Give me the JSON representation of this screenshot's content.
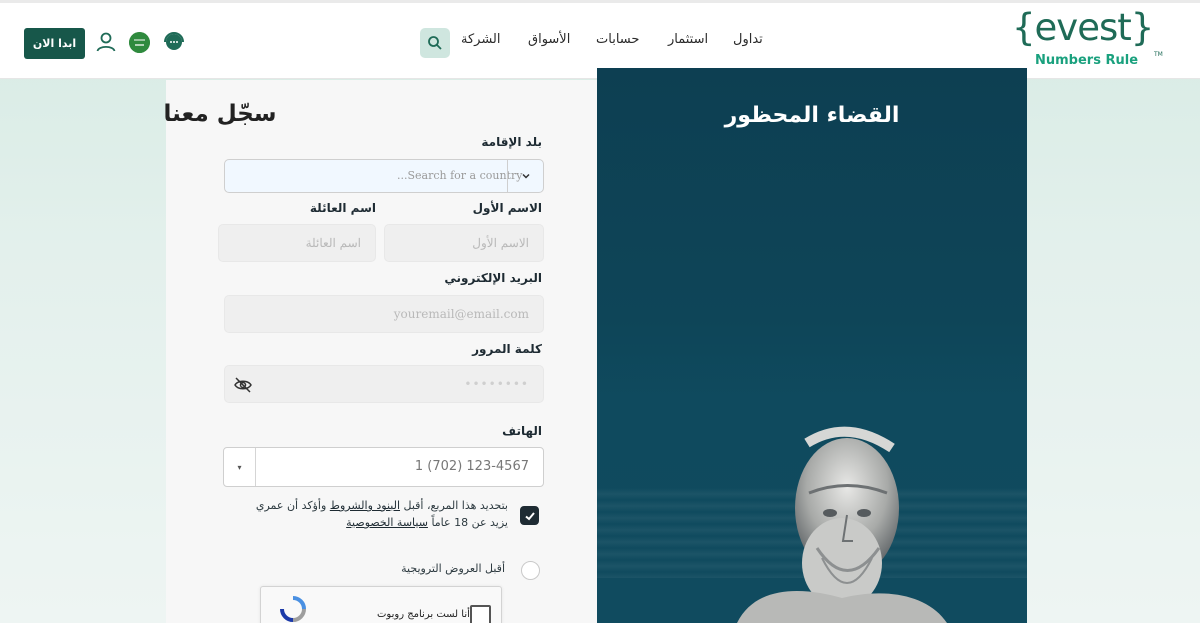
{
  "header": {
    "start_label": "ابدا الان",
    "nav": {
      "trade": "تداول",
      "invest": "استثمار",
      "accounts": "حسابات",
      "markets": "الأسواق",
      "company": "الشركة"
    },
    "logo": {
      "name": "{evest}",
      "tagline": "Numbers Rule",
      "tm": "TM"
    }
  },
  "form": {
    "title": "سجّل معنا",
    "country_label": "بلد الإقامة",
    "country_placeholder": "...Search for a country",
    "first_name_label": "الاسم الأول",
    "first_name_placeholder": "الاسم الأول",
    "last_name_label": "اسم العائلة",
    "last_name_placeholder": "اسم العائلة",
    "email_label": "البريد الإلكتروني",
    "email_placeholder": "youremail@email.com",
    "password_label": "كلمة المرور",
    "password_placeholder": "••••••••",
    "phone_label": "الهاتف",
    "phone_value": "1 (702) 123-4567",
    "terms_text_1": "بتحديد هذا المربع، أقبل",
    "terms_link_1": "البنود والشروط",
    "terms_text_2": "وأؤكد أن عمري يزيد عن 18 عاماً",
    "terms_link_2": "سياسة الخصوصية",
    "terms_checked": true,
    "promo_label": "أقبل العروض الترويجية",
    "promo_checked": false,
    "captcha_label": "أنا لست برنامج روبوت"
  },
  "hero": {
    "title": "القضاء المحظور"
  },
  "colors": {
    "brand": "#17574a",
    "logo_accent": "#1aa17e",
    "hero_bg": "#0d3f52"
  }
}
